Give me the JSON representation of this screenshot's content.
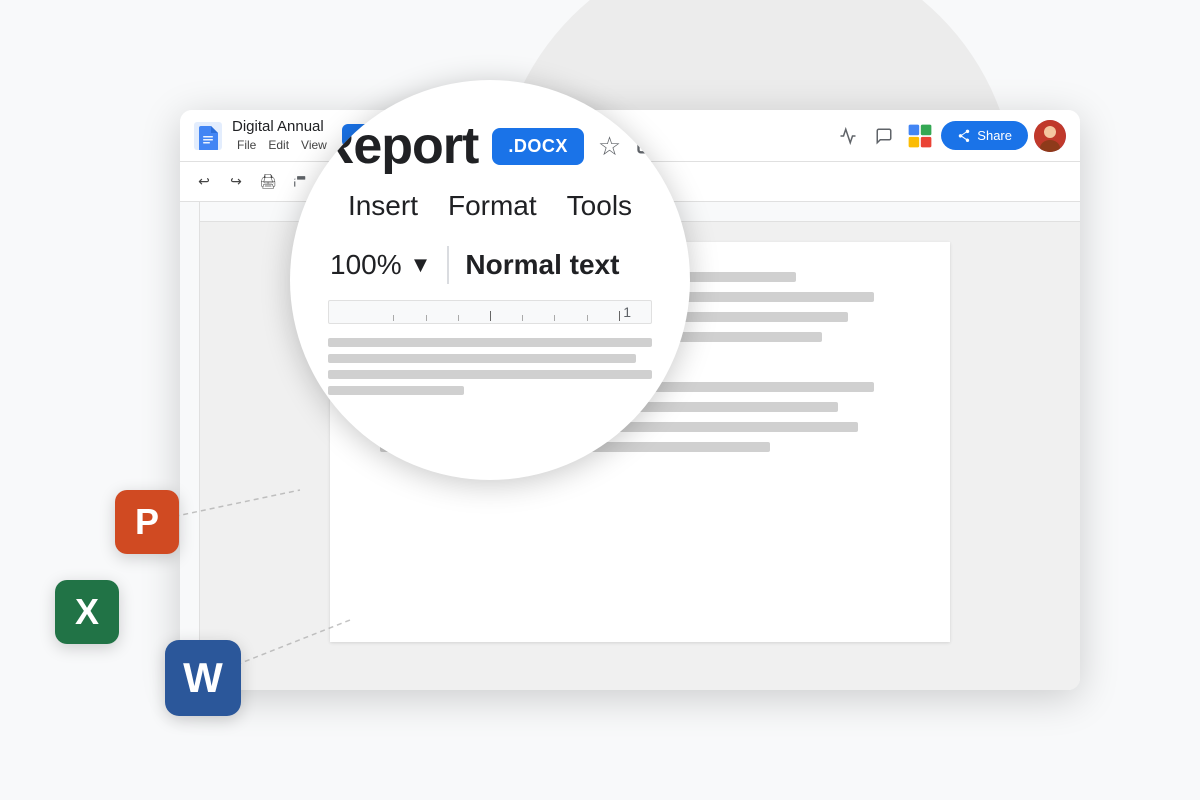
{
  "background": {
    "circle_color": "#ececec"
  },
  "browser": {
    "doc_title": "Digital Annual",
    "doc_subtitle": "Report",
    "docx_badge": ".DOCX",
    "menu_items": [
      "File",
      "Edit",
      "View"
    ],
    "share_label": "Share"
  },
  "magnify": {
    "title": "Report",
    "docx_badge": ".DOCX",
    "menu_insert": "Insert",
    "menu_format": "Format",
    "menu_tools": "Tools",
    "zoom": "100%",
    "text_style": "Normal text",
    "ruler_number": "1"
  },
  "floating_icons": {
    "powerpoint_letter": "P",
    "excel_letter": "X",
    "word_letter": "W"
  }
}
